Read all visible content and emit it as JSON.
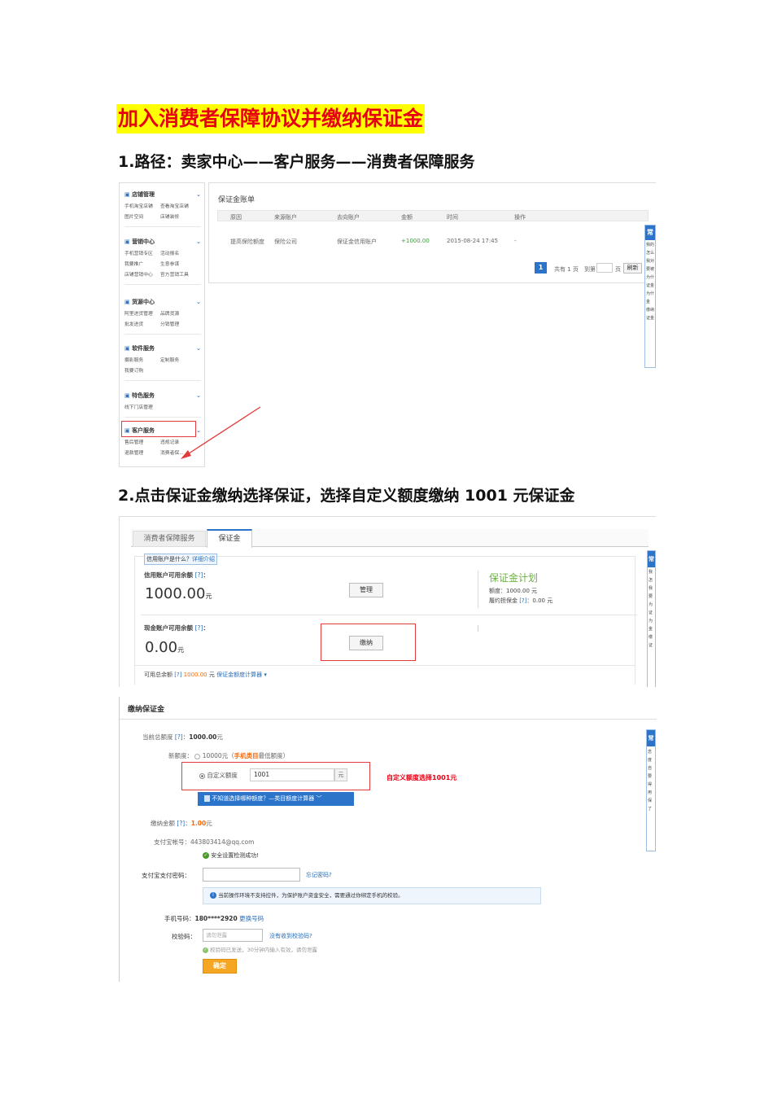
{
  "doc_title": "加入消费者保障协议并缴纳保证金",
  "step1_heading": "1.路径：卖家中心——客户服务——消费者保障服务",
  "step2_heading": "2.点击保证金缴纳选择保证，选择自定义额度缴纳 1001 元保证金",
  "sidebar": {
    "groups": [
      {
        "icon": "shop-icon",
        "title": "店铺管理",
        "links": [
          "手机淘宝店铺",
          "查看淘宝店铺",
          "图片空间",
          "店铺装修"
        ]
      },
      {
        "icon": "marketing-icon",
        "title": "营销中心",
        "links": [
          "手机营销专区",
          "活动报名",
          "我要推广",
          "生意参谋",
          "店铺营销中心",
          "官方营销工具"
        ]
      },
      {
        "icon": "supply-icon",
        "title": "货源中心",
        "links": [
          "阿里进货管理",
          "品牌货源",
          "批发进货",
          "分销管理"
        ]
      },
      {
        "icon": "grid-icon",
        "title": "软件服务",
        "links": [
          "摄影服务",
          "定制服务",
          "我要订购"
        ]
      },
      {
        "icon": "star-icon",
        "title": "特色服务",
        "links": [
          "线下门店管理"
        ]
      },
      {
        "icon": "customer-icon",
        "title": "客户服务",
        "links": [
          "售后管理",
          "违规记录",
          "退款管理",
          "消费者保..."
        ]
      }
    ]
  },
  "ledger": {
    "title": "保证金账单",
    "columns": [
      "原因",
      "来源账户",
      "去向账户",
      "金额",
      "时间",
      "操作"
    ],
    "rows": [
      [
        "提高保险额度",
        "保险公司",
        "保证金信用账户",
        "+1000.00",
        "2015-08-24 17:45",
        "-"
      ]
    ],
    "pager": {
      "current": "1",
      "total": "共有 1 页",
      "goto": "到第",
      "page_unit": "页",
      "refresh": "刷新"
    }
  },
  "side_panel1": {
    "head": "常",
    "items": [
      "我的",
      "怎么",
      "我对",
      "要被",
      "为什",
      "证金",
      "为什",
      "金",
      "缴纳",
      "证金"
    ]
  },
  "deposit": {
    "tabs": [
      "消费者保障服务",
      "保证金"
    ],
    "credit_question": "信用账户是什么？",
    "credit_link": "详细介绍",
    "credit_label": "信用账户可用余额",
    "help_mark": "[?]",
    "colon": "：",
    "credit_amount": "1000.00",
    "yuan": "元",
    "manage_btn": "管理",
    "plan_title": "保证金计划",
    "plan_quota": "额度：1000.00 元",
    "plan_perf": "履约担保金",
    "plan_perf_val": "：0.00 元",
    "cash_label": "现金账户可用余额",
    "cash_amount": "0.00",
    "pay_btn": "缴纳",
    "total_label": "可用总余额",
    "total_value": "1000.00",
    "total_unit": "元",
    "calc_link": "保证金额度计算器"
  },
  "side_panel2": {
    "head": "常",
    "items": [
      "我",
      "怎",
      "我",
      "要",
      "为",
      "证",
      "为",
      "金",
      "缴",
      "证"
    ]
  },
  "payform": {
    "title": "缴纳保证金",
    "current_total_label": "当前总额度",
    "current_total_value": "1000.00",
    "new_quota_label": "新额度：",
    "option1": "10000元",
    "option1_note_open": "（",
    "option1_note": "手机类目",
    "option1_note_tail": "最低额度）",
    "option2": "自定义额度",
    "custom_value": "1001",
    "custom_unit": "元",
    "annotation": "自定义额度选择1001元",
    "calc_banner": "不知道选择哪种额度？—类目额度计算器",
    "pay_amount_label": "缴纳金额",
    "pay_amount_value": "1.00",
    "alipay_label": "支付宝帐号：",
    "alipay_value": "443803414@qq.com",
    "security_ok": "安全设置检测成功!",
    "pwd_label": "支付宝支付密码：",
    "forgot_pwd": "忘记密码?",
    "notice": "当前操作环境不支持控件，为保护账户资金安全，需要通过你绑定手机的校验。",
    "phone_label": "手机号码：",
    "phone_value": "180****2920",
    "change_phone": "更换号码",
    "code_label": "校验码：",
    "code_placeholder": "请勿泄露",
    "no_code": "没有收到校验码?",
    "code_sent": "校验码已发送，30分钟内输入有效，请勿泄露",
    "confirm_btn": "确定"
  },
  "side_panel3": {
    "head": "常",
    "items": [
      "念",
      "度",
      "自",
      "要",
      "得",
      "用",
      "保",
      "了"
    ]
  },
  "colors": {
    "title_bg": "#ffff00",
    "title_fg": "#e60012",
    "accent_blue": "#2b74c9",
    "confirm": "#f5a623",
    "annotation": "#e23b3b"
  }
}
